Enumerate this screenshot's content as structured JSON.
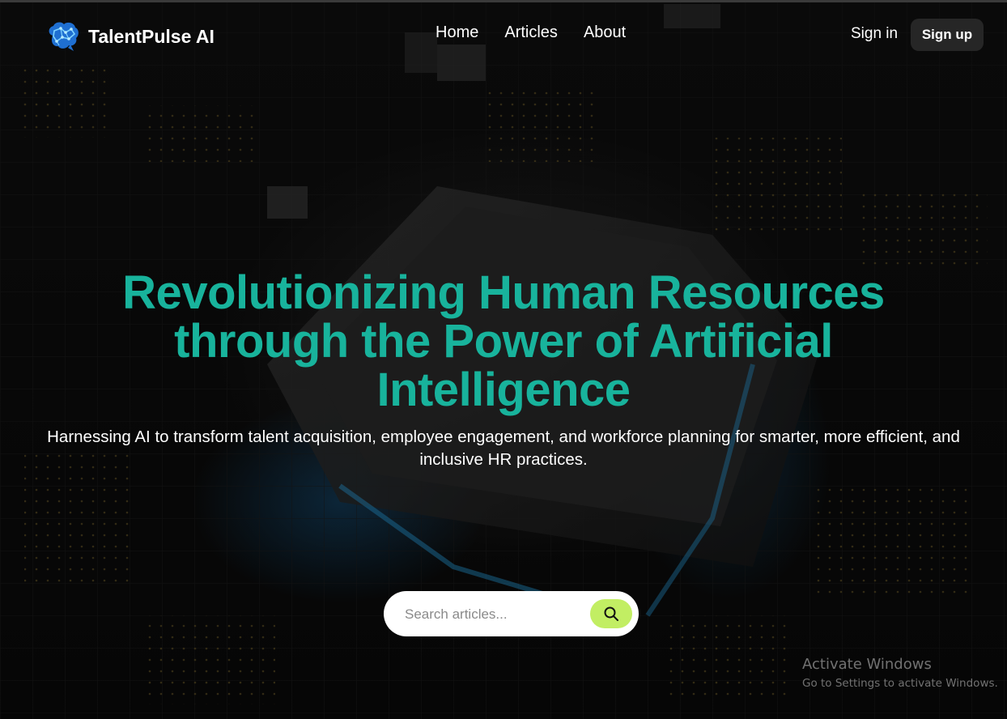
{
  "brand": {
    "name": "TalentPulse AI",
    "logo_icon": "brain-icon"
  },
  "nav": {
    "links": [
      "Home",
      "Articles",
      "About"
    ],
    "sign_in": "Sign in",
    "sign_up": "Sign up"
  },
  "hero": {
    "title": "Revolutionizing Human Resources through the Power of Artificial Intelligence",
    "subtitle": "Harnessing AI to transform talent acquisition, employee engagement, and workforce planning for smarter, more efficient, and inclusive HR practices."
  },
  "search": {
    "placeholder": "Search articles...",
    "button_icon": "search-icon"
  },
  "watermark": {
    "title": "Activate Windows",
    "subtitle": "Go to Settings to activate Windows."
  },
  "colors": {
    "accent": "#18b39c",
    "search_button": "#c2ee63",
    "signup_bg": "#262626"
  }
}
